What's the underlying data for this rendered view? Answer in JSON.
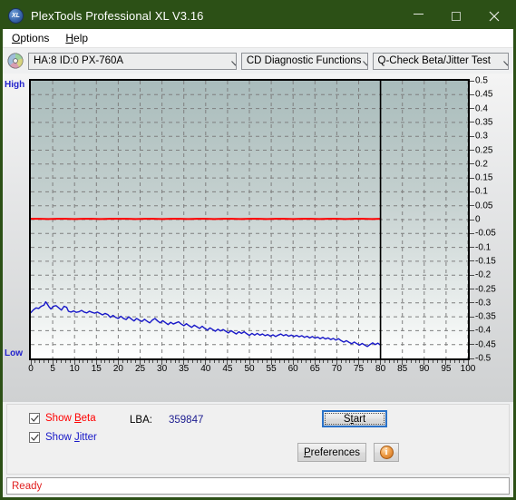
{
  "window": {
    "title": "PlexTools Professional XL V3.16",
    "app_icon": "xl-disc-icon",
    "minimize_label": "Minimize",
    "maximize_label": "Maximize",
    "close_label": "Close",
    "title_bar_color": "#2c5016"
  },
  "menu": {
    "items": [
      {
        "label": "Options",
        "accel": "O"
      },
      {
        "label": "Help",
        "accel": "H"
      }
    ]
  },
  "toolbar": {
    "drive_select": "HA:8 ID:0  PX-760A",
    "function_select": "CD Diagnostic Functions",
    "test_select": "Q-Check Beta/Jitter Test"
  },
  "chart_data": {
    "type": "line",
    "title": "",
    "xlabel": "",
    "ylabel": "",
    "xlim": [
      0,
      100
    ],
    "ylim": [
      -0.5,
      0.5
    ],
    "grid": true,
    "left_axis_labels": {
      "high": "High",
      "low": "Low"
    },
    "xticks": [
      0,
      5,
      10,
      15,
      20,
      25,
      30,
      35,
      40,
      45,
      50,
      55,
      60,
      65,
      70,
      75,
      80,
      85,
      90,
      95,
      100
    ],
    "yticks": [
      "0.5",
      "0.45",
      "0.4",
      "0.35",
      "0.3",
      "0.25",
      "0.2",
      "0.15",
      "0.1",
      "0.05",
      "0",
      "-0.05",
      "-0.1",
      "-0.15",
      "-0.2",
      "-0.25",
      "-0.3",
      "-0.35",
      "-0.4",
      "-0.45",
      "-0.5"
    ],
    "ytick_values": [
      0.5,
      0.45,
      0.4,
      0.35,
      0.3,
      0.25,
      0.2,
      0.15,
      0.1,
      0.05,
      0,
      -0.05,
      -0.1,
      -0.15,
      -0.2,
      -0.25,
      -0.3,
      -0.35,
      -0.4,
      -0.45,
      -0.5
    ],
    "data_end_x": 80,
    "marker_line_x": 80,
    "series": [
      {
        "name": "Beta",
        "color": "#ff0000",
        "x": [
          0,
          2,
          4,
          6,
          8,
          10,
          12,
          14,
          16,
          18,
          20,
          22,
          24,
          26,
          28,
          30,
          32,
          34,
          36,
          38,
          40,
          42,
          44,
          46,
          48,
          50,
          52,
          54,
          56,
          58,
          60,
          62,
          64,
          66,
          68,
          70,
          72,
          74,
          76,
          78,
          80
        ],
        "values": [
          0.003,
          0.003,
          0.002,
          0.003,
          0.003,
          0.002,
          0.003,
          0.003,
          0.002,
          0.003,
          0.003,
          0.003,
          0.002,
          0.003,
          0.003,
          0.002,
          0.003,
          0.003,
          0.002,
          0.003,
          0.003,
          0.002,
          0.003,
          0.003,
          0.002,
          0.003,
          0.003,
          0.002,
          0.003,
          0.003,
          0.002,
          0.003,
          0.003,
          0.002,
          0.003,
          0.003,
          0.002,
          0.003,
          0.003,
          0.002,
          0.003
        ]
      },
      {
        "name": "Jitter",
        "color": "#1818c8",
        "x": [
          0,
          0.6,
          1.2,
          1.8,
          2.4,
          3,
          3.4,
          3.8,
          4.2,
          4.6,
          5.2,
          5.8,
          6.4,
          7,
          7.6,
          8.2,
          8.6,
          9.2,
          9.8,
          10.4,
          11,
          11.6,
          12.2,
          12.8,
          13.4,
          14,
          14.6,
          15.2,
          15.8,
          16.4,
          17,
          17.6,
          18.2,
          18.8,
          19.4,
          20,
          20.6,
          21.2,
          21.8,
          22.4,
          23,
          23.6,
          24.2,
          24.8,
          25.4,
          26,
          26.6,
          27.2,
          27.8,
          28.4,
          29,
          29.6,
          30.2,
          30.8,
          31.4,
          32,
          32.6,
          33.2,
          33.8,
          34.4,
          35,
          35.6,
          36.2,
          36.8,
          37.4,
          38,
          38.6,
          39.2,
          39.8,
          40.4,
          41,
          41.6,
          42.2,
          42.8,
          43.4,
          44,
          44.6,
          45.2,
          45.8,
          46.4,
          47,
          47.6,
          48.2,
          48.8,
          49.4,
          50,
          50.6,
          51.2,
          51.8,
          52.4,
          53,
          53.6,
          54.2,
          54.8,
          55.4,
          56,
          56.6,
          57.2,
          57.8,
          58.4,
          59,
          59.6,
          60.2,
          60.8,
          61.4,
          62,
          62.6,
          63.2,
          63.8,
          64.4,
          65,
          65.6,
          66.2,
          66.8,
          67.4,
          68,
          68.6,
          69.2,
          69.8,
          70.4,
          71,
          71.6,
          72.2,
          72.8,
          73.4,
          74,
          74.6,
          75.2,
          75.8,
          76.4,
          77,
          77.6,
          78.2,
          78.8,
          79.4,
          80
        ],
        "values": [
          -0.335,
          -0.325,
          -0.318,
          -0.32,
          -0.312,
          -0.308,
          -0.296,
          -0.305,
          -0.315,
          -0.322,
          -0.312,
          -0.31,
          -0.318,
          -0.326,
          -0.312,
          -0.316,
          -0.33,
          -0.333,
          -0.329,
          -0.334,
          -0.332,
          -0.327,
          -0.333,
          -0.336,
          -0.33,
          -0.334,
          -0.337,
          -0.333,
          -0.338,
          -0.343,
          -0.338,
          -0.342,
          -0.352,
          -0.345,
          -0.352,
          -0.356,
          -0.348,
          -0.356,
          -0.36,
          -0.35,
          -0.358,
          -0.365,
          -0.356,
          -0.362,
          -0.367,
          -0.359,
          -0.366,
          -0.372,
          -0.362,
          -0.356,
          -0.365,
          -0.372,
          -0.364,
          -0.371,
          -0.378,
          -0.37,
          -0.376,
          -0.372,
          -0.368,
          -0.376,
          -0.382,
          -0.375,
          -0.382,
          -0.388,
          -0.38,
          -0.386,
          -0.392,
          -0.384,
          -0.392,
          -0.398,
          -0.39,
          -0.396,
          -0.402,
          -0.395,
          -0.401,
          -0.396,
          -0.402,
          -0.408,
          -0.4,
          -0.406,
          -0.412,
          -0.404,
          -0.41,
          -0.404,
          -0.411,
          -0.417,
          -0.41,
          -0.416,
          -0.41,
          -0.416,
          -0.412,
          -0.418,
          -0.414,
          -0.42,
          -0.415,
          -0.421,
          -0.416,
          -0.412,
          -0.418,
          -0.414,
          -0.42,
          -0.416,
          -0.421,
          -0.417,
          -0.422,
          -0.418,
          -0.424,
          -0.42,
          -0.426,
          -0.421,
          -0.427,
          -0.423,
          -0.429,
          -0.424,
          -0.43,
          -0.426,
          -0.432,
          -0.428,
          -0.434,
          -0.429,
          -0.436,
          -0.441,
          -0.436,
          -0.442,
          -0.447,
          -0.441,
          -0.447,
          -0.452,
          -0.446,
          -0.452,
          -0.457,
          -0.45,
          -0.444,
          -0.45,
          -0.445,
          -0.452,
          -0.446
        ]
      }
    ]
  },
  "controls": {
    "show_beta": {
      "label_prefix": "Show ",
      "label_accel": "B",
      "label_suffix": "eta",
      "checked": true,
      "color": "#ff0000"
    },
    "show_jitter": {
      "label_prefix": "Show ",
      "label_accel": "J",
      "label_suffix": "itter",
      "checked": true,
      "color": "#1818c8"
    },
    "lba_label": "LBA:",
    "lba_value": "359847",
    "start_button": {
      "prefix": "S",
      "accel": "t",
      "suffix": "art",
      "label": "Start"
    },
    "preferences_button": {
      "prefix": "",
      "accel": "P",
      "suffix": "references",
      "label": "Preferences"
    },
    "info_button": "i"
  },
  "status": {
    "text": "Ready",
    "color": "#e02020"
  }
}
